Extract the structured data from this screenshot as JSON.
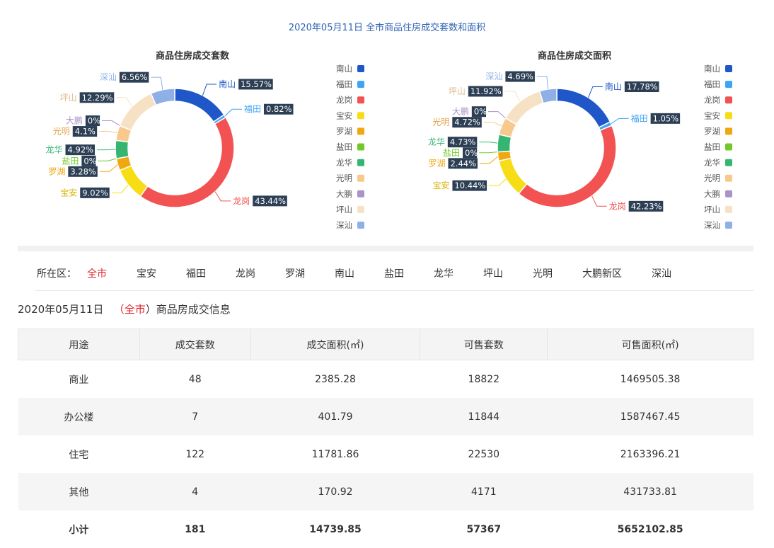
{
  "header": {
    "title": "2020年05月11日 全市商品住房成交套数和面积"
  },
  "chart_data": [
    {
      "type": "pie",
      "title": "商品住房成交套数",
      "categories": [
        "南山",
        "福田",
        "龙岗",
        "宝安",
        "罗湖",
        "盐田",
        "龙华",
        "光明",
        "大鹏",
        "坪山",
        "深汕"
      ],
      "values": [
        15.57,
        0.82,
        43.44,
        9.02,
        3.28,
        0,
        4.92,
        4.1,
        0,
        12.29,
        6.56
      ],
      "value_labels": [
        "15.57%",
        "0.82%",
        "43.44%",
        "9.02%",
        "3.28%",
        "0%",
        "4.92%",
        "4.1%",
        "0%",
        "12.29%",
        "6.56%"
      ],
      "colors": [
        "#1f57c9",
        "#3da3f5",
        "#f25252",
        "#f7dd16",
        "#f0a811",
        "#72c72b",
        "#35b571",
        "#f8c98c",
        "#a993c7",
        "#f7e1c5",
        "#8eb0e6"
      ],
      "legend_position": "right"
    },
    {
      "type": "pie",
      "title": "商品住房成交面积",
      "categories": [
        "南山",
        "福田",
        "龙岗",
        "宝安",
        "罗湖",
        "盐田",
        "龙华",
        "光明",
        "大鹏",
        "坪山",
        "深汕"
      ],
      "values": [
        17.78,
        1.05,
        42.23,
        10.44,
        2.44,
        0,
        4.73,
        4.72,
        0,
        11.92,
        4.69
      ],
      "value_labels": [
        "17.78%",
        "1.05%",
        "42.23%",
        "10.44%",
        "2.44%",
        "0%",
        "4.73%",
        "4.72%",
        "0%",
        "11.92%",
        "4.69%"
      ],
      "colors": [
        "#1f57c9",
        "#3da3f5",
        "#f25252",
        "#f7dd16",
        "#f0a811",
        "#72c72b",
        "#35b571",
        "#f8c98c",
        "#a993c7",
        "#f7e1c5",
        "#8eb0e6"
      ],
      "legend_position": "right"
    }
  ],
  "filter": {
    "label": "所在区：",
    "items": [
      "全市",
      "宝安",
      "福田",
      "龙岗",
      "罗湖",
      "南山",
      "盐田",
      "龙华",
      "坪山",
      "光明",
      "大鹏新区",
      "深汕"
    ],
    "active": "全市"
  },
  "info": {
    "date": "2020年05月11日",
    "open": "（",
    "scope": "全市",
    "close": "）",
    "suffix": "商品房成交信息"
  },
  "table": {
    "headers": [
      "用途",
      "成交套数",
      "成交面积(㎡)",
      "可售套数",
      "可售面积(㎡)"
    ],
    "rows": [
      [
        "商业",
        "48",
        "2385.28",
        "18822",
        "1469505.38"
      ],
      [
        "办公楼",
        "7",
        "401.79",
        "11844",
        "1587467.45"
      ],
      [
        "住宅",
        "122",
        "11781.86",
        "22530",
        "2163396.21"
      ],
      [
        "其他",
        "4",
        "170.92",
        "4171",
        "431733.81"
      ]
    ],
    "total": [
      "小计",
      "181",
      "14739.85",
      "57367",
      "5652102.85"
    ]
  }
}
